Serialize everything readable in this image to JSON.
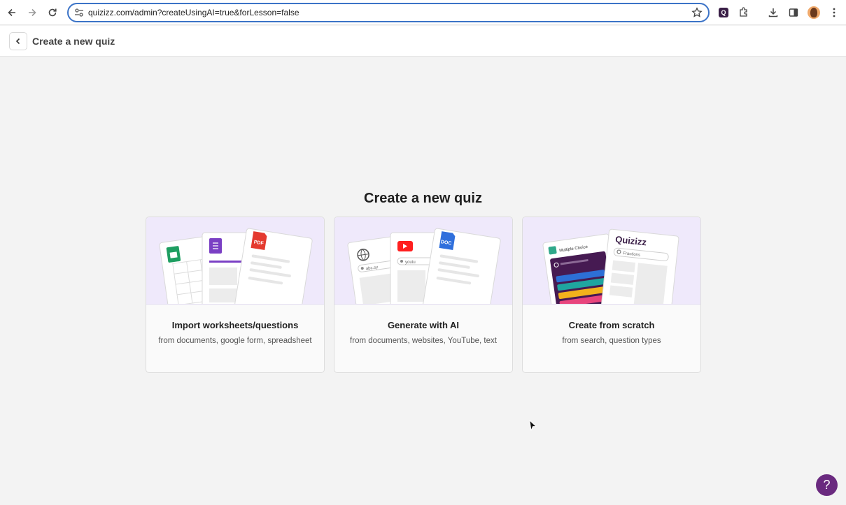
{
  "browser": {
    "url": "quizizz.com/admin?createUsingAI=true&forLesson=false"
  },
  "header": {
    "title": "Create a new quiz"
  },
  "main": {
    "title": "Create a new quiz",
    "cards": [
      {
        "title": "Import worksheets/questions",
        "subtitle": "from documents, google form, spreadsheet",
        "art_labels": {
          "pdf": "PDF"
        }
      },
      {
        "title": "Generate with AI",
        "subtitle": "from documents, websites, YouTube, text",
        "art_labels": {
          "web": "abc.sy",
          "youtube": "youtu",
          "doc": "DOC"
        }
      },
      {
        "title": "Create from scratch",
        "subtitle": "from search, question types",
        "art_labels": {
          "mc": "Multiple Choice",
          "brand": "Quizizz",
          "search": "Fractions"
        }
      }
    ]
  },
  "help": {
    "label": "?"
  },
  "colors": {
    "accent": "#3b73c7",
    "brand_purple": "#6a2a7f",
    "card_art_bg": "#efe9fb"
  }
}
